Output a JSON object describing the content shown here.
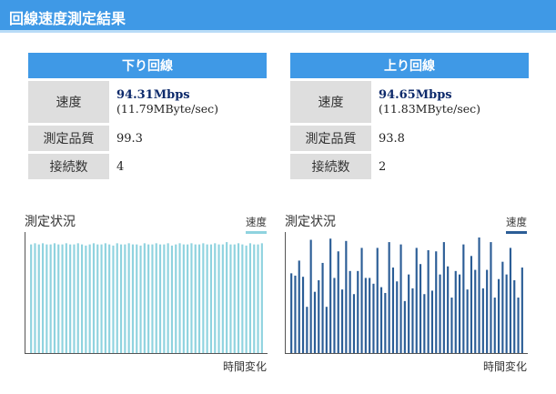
{
  "title": "回線速度測定結果",
  "download": {
    "header": "下り回線",
    "speed_label": "速度",
    "speed_mbps": "94.31Mbps",
    "speed_mbyte": "(11.79MByte/sec)",
    "quality_label": "測定品質",
    "quality": "99.3",
    "connections_label": "接続数",
    "connections": "4",
    "chart_title": "測定状況",
    "legend": "速度",
    "x_label": "時間変化"
  },
  "upload": {
    "header": "上り回線",
    "speed_label": "速度",
    "speed_mbps": "94.65Mbps",
    "speed_mbyte": "(11.83MByte/sec)",
    "quality_label": "測定品質",
    "quality": "93.8",
    "connections_label": "接続数",
    "connections": "2",
    "chart_title": "測定状況",
    "legend": "速度",
    "x_label": "時間変化"
  },
  "colors": {
    "accent": "#3f99e6",
    "download_series": "#8fd3df",
    "upload_series": "#2b5d96"
  },
  "chart_data": [
    {
      "type": "bar",
      "name": "download",
      "series": [
        {
          "name": "速度",
          "values": [
            94,
            95,
            94,
            95,
            94,
            94,
            95,
            94,
            94,
            95,
            94,
            94,
            95,
            94,
            93,
            94,
            95,
            94,
            94,
            95,
            94,
            93,
            95,
            94,
            94,
            95,
            94,
            94,
            93,
            95,
            94,
            94,
            95,
            94,
            94,
            95,
            93,
            94,
            95,
            94,
            94,
            95,
            94,
            94,
            95,
            94,
            94,
            95,
            94,
            94,
            96,
            94,
            94,
            95,
            94,
            93,
            95,
            94,
            94,
            95
          ]
        }
      ],
      "ylim": [
        0,
        100
      ]
    },
    {
      "type": "bar",
      "name": "upload",
      "series": [
        {
          "name": "速度",
          "values": [
            69,
            67,
            80,
            66,
            40,
            98,
            53,
            63,
            78,
            40,
            99,
            65,
            88,
            55,
            97,
            71,
            51,
            71,
            91,
            65,
            65,
            60,
            91,
            57,
            52,
            96,
            74,
            62,
            94,
            45,
            68,
            56,
            91,
            77,
            51,
            89,
            54,
            88,
            68,
            96,
            75,
            48,
            71,
            68,
            94,
            55,
            84,
            72,
            100,
            56,
            72,
            96,
            48,
            64,
            79,
            68,
            91,
            63,
            48,
            74
          ]
        }
      ],
      "ylim": [
        0,
        100
      ]
    }
  ]
}
